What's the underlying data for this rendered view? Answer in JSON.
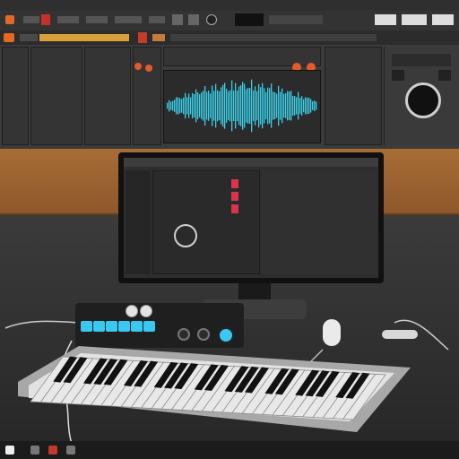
{
  "scene": {
    "description_key": "music-production-workstation"
  },
  "colors": {
    "waveform": "#3ad0e8",
    "pad_accent": "#38c8f0",
    "wood": "#a86d36",
    "desk": "#2f2f2f"
  },
  "icons": {
    "start": "start-icon",
    "app": "app-icon",
    "knob": "knob-icon"
  }
}
